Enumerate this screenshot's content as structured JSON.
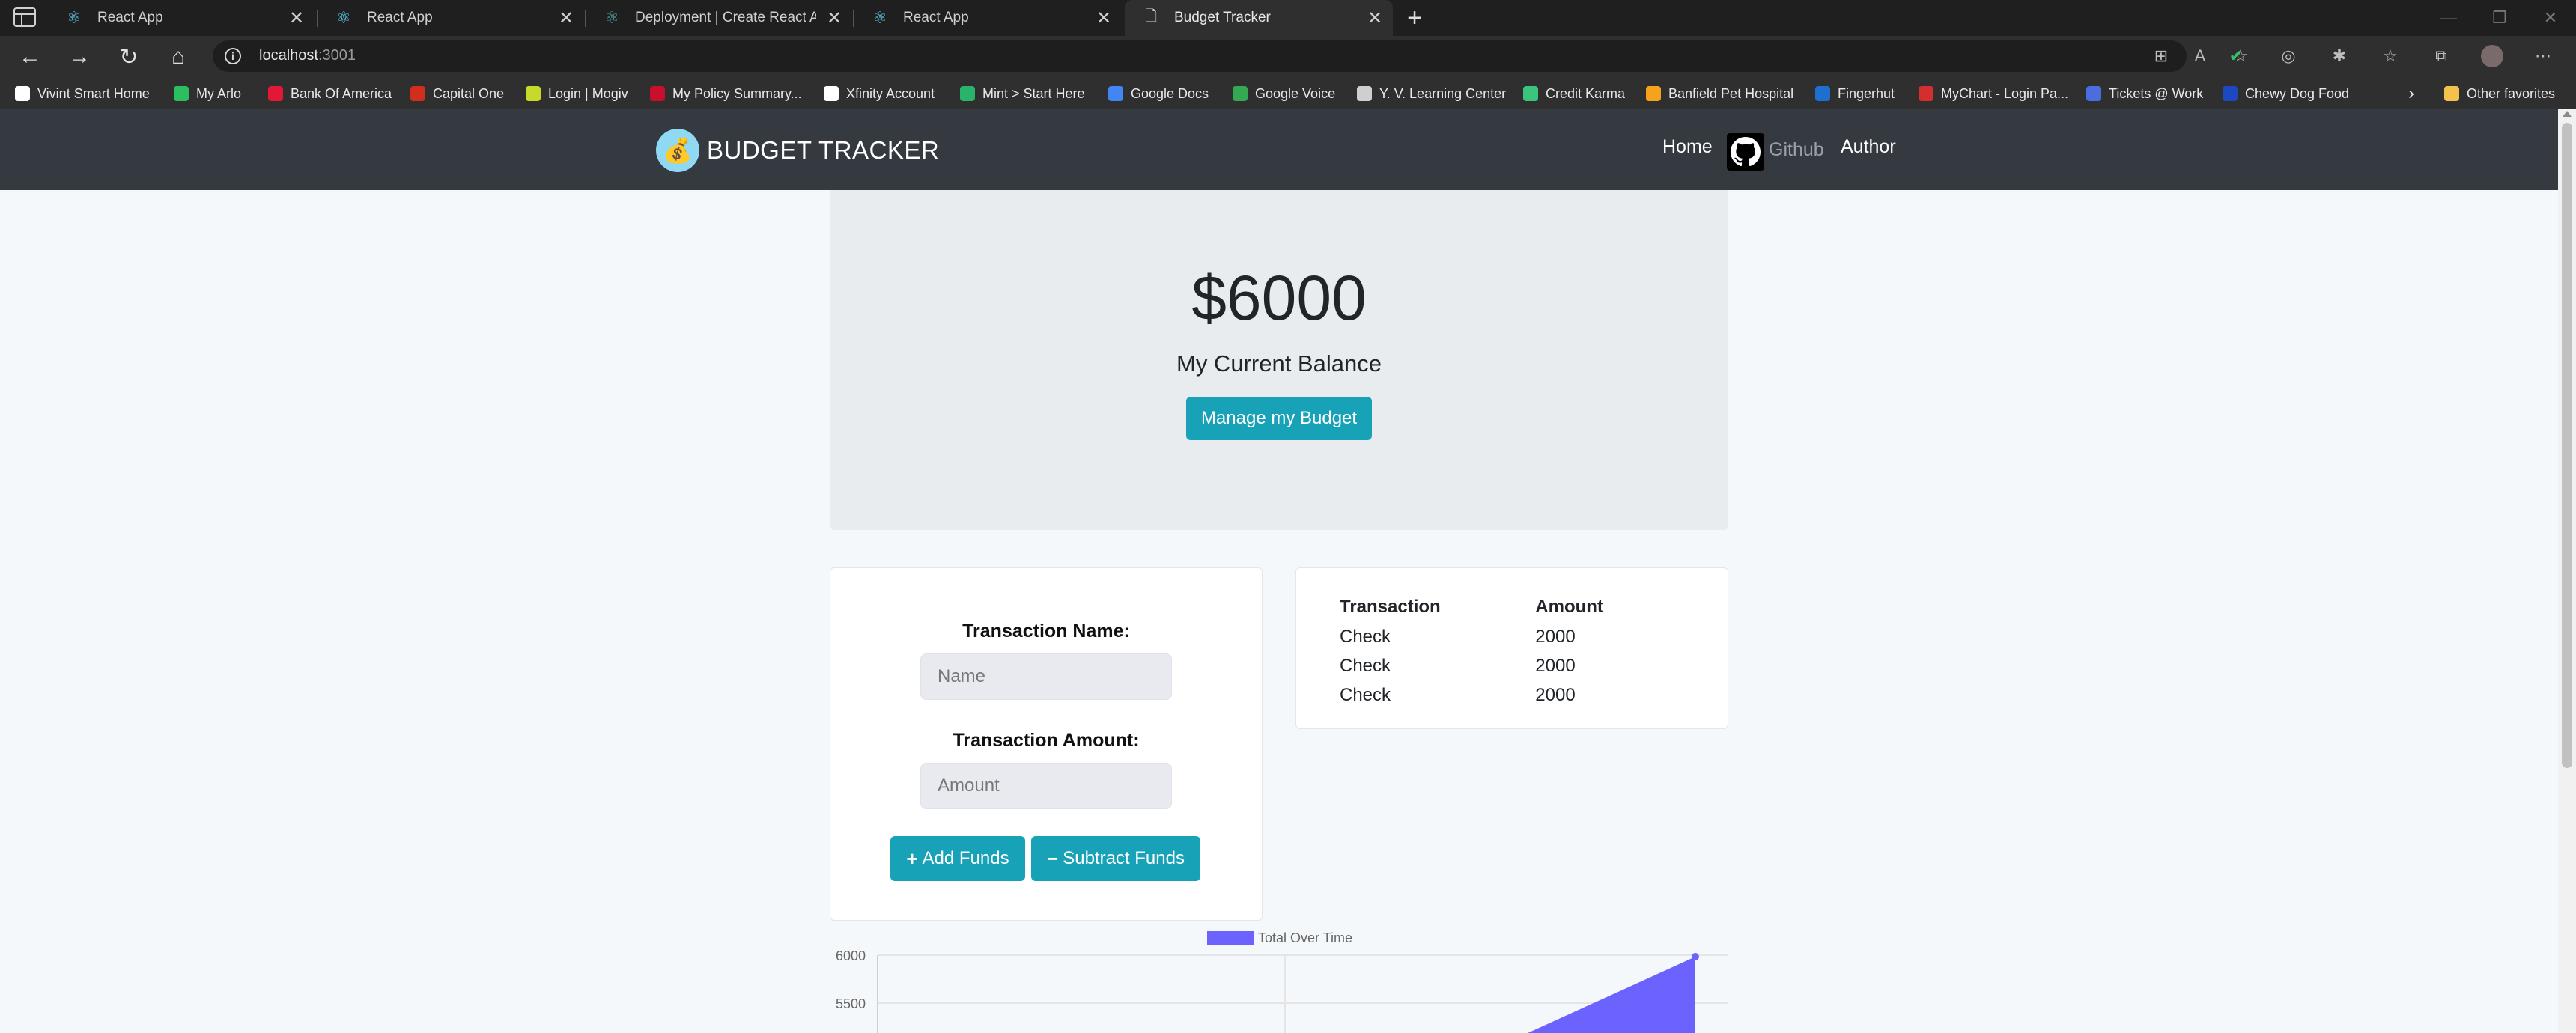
{
  "browser": {
    "tabs": [
      {
        "title": "React App",
        "icon": "react-icon",
        "active": false
      },
      {
        "title": "React App",
        "icon": "react-icon",
        "active": false
      },
      {
        "title": "Deployment | Create React App",
        "icon": "react-icon",
        "active": false
      },
      {
        "title": "React App",
        "icon": "react-icon",
        "active": false
      },
      {
        "title": "Budget Tracker",
        "icon": "page-icon",
        "active": true
      }
    ],
    "close_glyph": "✕",
    "new_tab_glyph": "+",
    "address": {
      "host": "localhost",
      "port": ":3001"
    },
    "bookmarks": [
      {
        "label": "Vivint Smart Home",
        "color": "#ffffff"
      },
      {
        "label": "My Arlo",
        "color": "#2dbe60"
      },
      {
        "label": "Bank Of America",
        "color": "#e31837"
      },
      {
        "label": "Capital One",
        "color": "#d22e1e"
      },
      {
        "label": "Login | Mogiv",
        "color": "#c7d92b"
      },
      {
        "label": "My Policy Summary...",
        "color": "#c8102e"
      },
      {
        "label": "Xfinity Account",
        "color": "#ffffff"
      },
      {
        "label": "Mint > Start Here",
        "color": "#2ab36a"
      },
      {
        "label": "Google Docs",
        "color": "#4285f4"
      },
      {
        "label": "Google Voice",
        "color": "#34a853"
      },
      {
        "label": "Y. V. Learning Center",
        "color": "#cfcfcf"
      },
      {
        "label": "Credit Karma",
        "color": "#3ac47d"
      },
      {
        "label": "Banfield Pet Hospital",
        "color": "#f7a21b"
      },
      {
        "label": "Fingerhut",
        "color": "#1f6fd1"
      },
      {
        "label": "MyChart - Login Pa...",
        "color": "#d32f2f"
      },
      {
        "label": "Tickets @ Work",
        "color": "#4a6ee0"
      },
      {
        "label": "Chewy Dog Food",
        "color": "#1c49c2"
      }
    ],
    "other_favorites": "Other favorites"
  },
  "app": {
    "brand": "BUDGET TRACKER",
    "logo_glyph": "💰",
    "nav": {
      "home": "Home",
      "github": "Github",
      "author": "Author"
    },
    "balance": "$6000",
    "balance_label": "My Current Balance",
    "manage_button": "Manage my Budget",
    "form": {
      "name_label": "Transaction Name:",
      "name_placeholder": "Name",
      "amount_label": "Transaction Amount:",
      "amount_placeholder": "Amount",
      "add_button": "Add Funds",
      "subtract_button": "Subtract Funds"
    },
    "table": {
      "headers": [
        "Transaction",
        "Amount"
      ],
      "rows": [
        [
          "Check",
          "2000"
        ],
        [
          "Check",
          "2000"
        ],
        [
          "Check",
          "2000"
        ]
      ]
    }
  },
  "chart_data": {
    "type": "area",
    "series": [
      {
        "name": "Total Over Time",
        "color": "#6c63ff"
      }
    ],
    "y_ticks": [
      "6000",
      "5500"
    ],
    "last_value": 6000
  }
}
